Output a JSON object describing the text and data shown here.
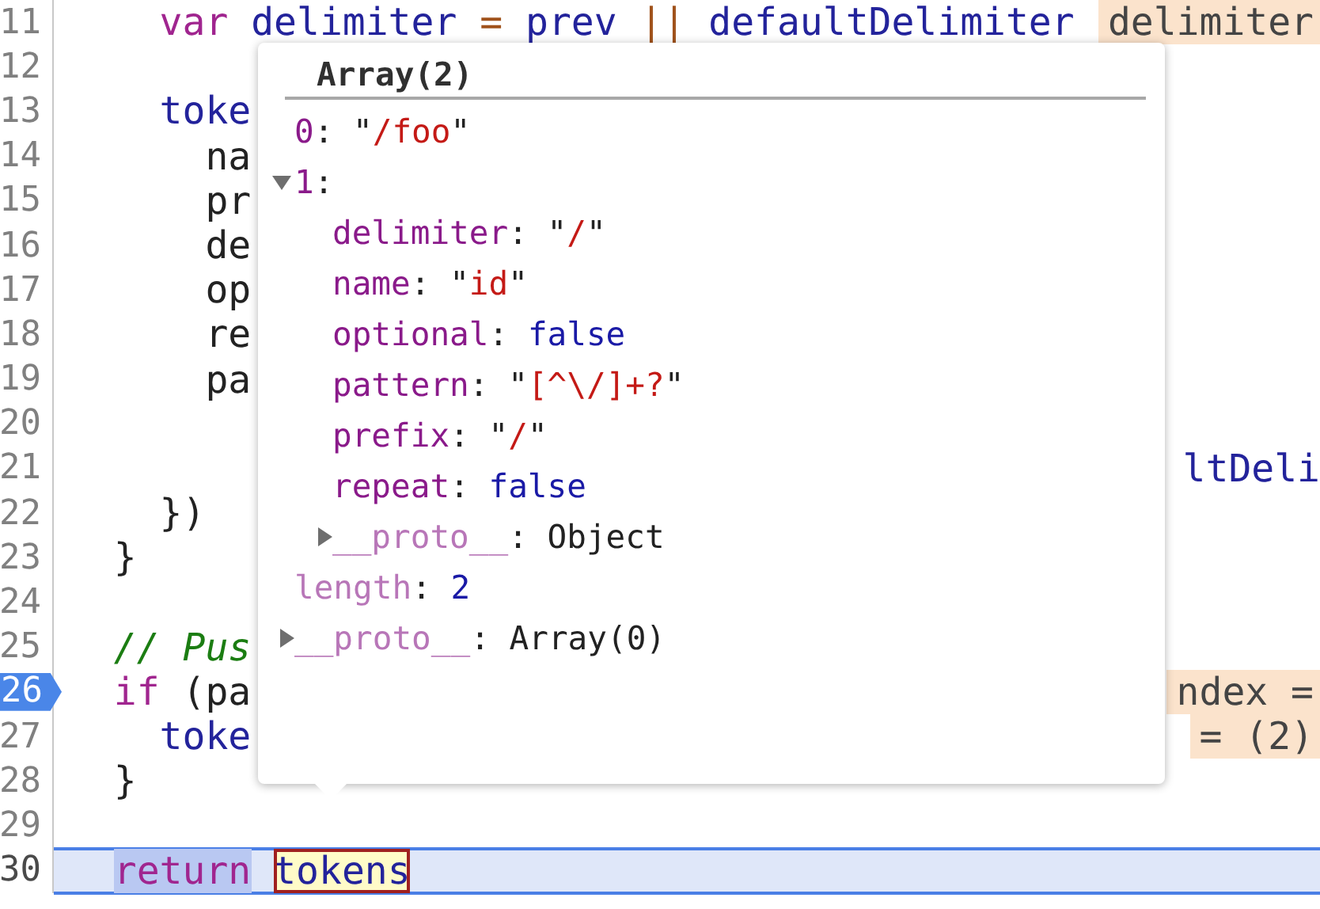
{
  "editor": {
    "lines": [
      {
        "number": "11",
        "breakpoint": false,
        "current": false,
        "tokens": [
          {
            "text": "    var",
            "kind": "keyword"
          },
          {
            "text": " delimiter",
            "kind": "name"
          },
          {
            "text": " =",
            "kind": "operator"
          },
          {
            "text": " prev",
            "kind": "name"
          },
          {
            "text": " ||",
            "kind": "operator"
          },
          {
            "text": " defaultDelimiter",
            "kind": "name"
          }
        ],
        "inline": [
          {
            "text": "delimiter",
            "kind": "value"
          }
        ]
      },
      {
        "number": "12",
        "breakpoint": false,
        "current": false
      },
      {
        "number": "13",
        "breakpoint": false,
        "current": false,
        "tokens": [
          {
            "text": "    toke",
            "kind": "name"
          }
        ]
      },
      {
        "number": "14",
        "breakpoint": false,
        "current": false,
        "tokens": [
          {
            "text": "      na",
            "kind": "plain"
          }
        ]
      },
      {
        "number": "15",
        "breakpoint": false,
        "current": false,
        "tokens": [
          {
            "text": "      pr",
            "kind": "plain"
          }
        ]
      },
      {
        "number": "16",
        "breakpoint": false,
        "current": false,
        "tokens": [
          {
            "text": "      de",
            "kind": "plain"
          }
        ]
      },
      {
        "number": "17",
        "breakpoint": false,
        "current": false,
        "tokens": [
          {
            "text": "      op",
            "kind": "plain"
          }
        ]
      },
      {
        "number": "18",
        "breakpoint": false,
        "current": false,
        "tokens": [
          {
            "text": "      re",
            "kind": "plain"
          }
        ]
      },
      {
        "number": "19",
        "breakpoint": false,
        "current": false,
        "tokens": [
          {
            "text": "      pa",
            "kind": "plain"
          }
        ]
      },
      {
        "number": "20",
        "breakpoint": false,
        "current": false
      },
      {
        "number": "21",
        "breakpoint": false,
        "current": false,
        "inline": [
          {
            "text": "ltDeli",
            "kind": "name"
          }
        ]
      },
      {
        "number": "22",
        "breakpoint": false,
        "current": false,
        "tokens": [
          {
            "text": "    })",
            "kind": "plain"
          }
        ]
      },
      {
        "number": "23",
        "breakpoint": false,
        "current": false,
        "tokens": [
          {
            "text": "  }",
            "kind": "plain"
          }
        ]
      },
      {
        "number": "24",
        "breakpoint": false,
        "current": false
      },
      {
        "number": "25",
        "breakpoint": false,
        "current": false,
        "tokens": [
          {
            "text": "  // Pus",
            "kind": "comment"
          }
        ]
      },
      {
        "number": "26",
        "breakpoint": true,
        "current": false,
        "tokens": [
          {
            "text": "  if",
            "kind": "keyword"
          },
          {
            "text": " (pa",
            "kind": "plain"
          }
        ],
        "inline": [
          {
            "text": "ndex =",
            "kind": "value"
          }
        ]
      },
      {
        "number": "27",
        "breakpoint": false,
        "current": false,
        "tokens": [
          {
            "text": "    toke",
            "kind": "name"
          }
        ],
        "inline": [
          {
            "text": "= (2)",
            "kind": "value"
          }
        ]
      },
      {
        "number": "28",
        "breakpoint": false,
        "current": false,
        "tokens": [
          {
            "text": "  }",
            "kind": "plain"
          }
        ]
      },
      {
        "number": "29",
        "breakpoint": false,
        "current": false
      },
      {
        "number": "30",
        "breakpoint": false,
        "current": true,
        "tokens": [
          {
            "text": "  return",
            "kind": "selection"
          },
          {
            "text": "tokens",
            "kind": "hovered"
          }
        ]
      }
    ]
  },
  "popover": {
    "title": "Array(2)",
    "items": [
      {
        "key": "0:",
        "dimmed": false,
        "value": "\"/foo\"",
        "kind": "string"
      },
      {
        "key": "1:",
        "dimmed": false,
        "expanded": true,
        "children": [
          {
            "key": "delimiter:",
            "dimmed": false,
            "value": "\"/\"",
            "kind": "string"
          },
          {
            "key": "name:",
            "dimmed": false,
            "value": "\"id\"",
            "kind": "string"
          },
          {
            "key": "optional:",
            "dimmed": false,
            "value": "false",
            "kind": "literal"
          },
          {
            "key": "pattern:",
            "dimmed": false,
            "value": "\"[^\\/]+?\"",
            "kind": "string"
          },
          {
            "key": "prefix:",
            "dimmed": false,
            "value": "\"/\"",
            "kind": "string"
          },
          {
            "key": "repeat:",
            "dimmed": false,
            "value": "false",
            "kind": "literal"
          },
          {
            "key": "__proto__:",
            "dimmed": true,
            "value": "Object",
            "kind": "object",
            "expanded": false
          }
        ]
      },
      {
        "key": "length:",
        "dimmed": true,
        "value": "2",
        "kind": "literal"
      },
      {
        "key": "__proto__:",
        "dimmed": true,
        "value": "Array(0)",
        "kind": "object",
        "expanded": false
      }
    ]
  }
}
